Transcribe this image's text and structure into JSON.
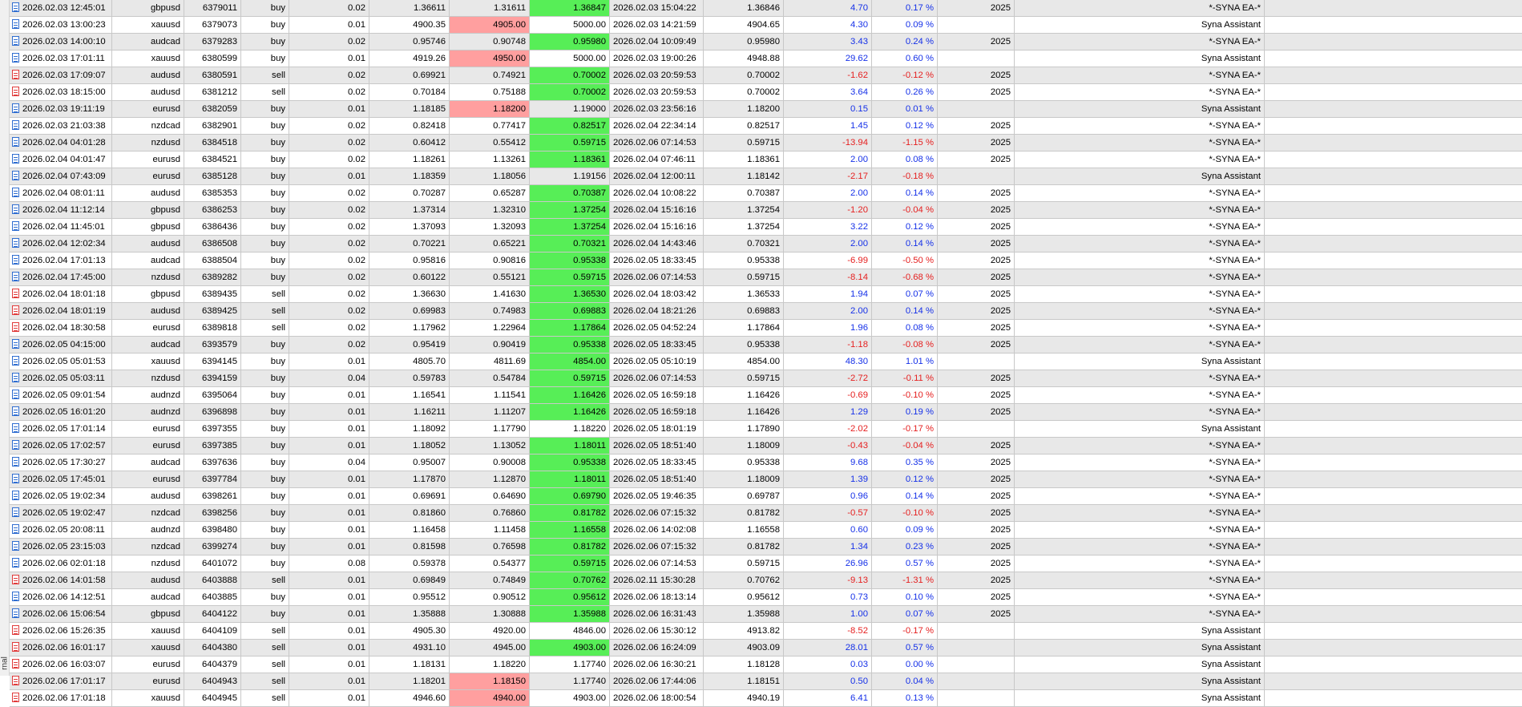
{
  "side_label": "rnal",
  "theme": {
    "profit_color": "#1530e8",
    "loss_color": "#e52020",
    "tp_highlight": "#57ee57",
    "sl_highlight": "#ff9f9f"
  },
  "rows": [
    {
      "time": "2026.02.03 12:45:01",
      "symbol": "gbpusd",
      "ticket": "6379011",
      "type": "buy",
      "volume": "0.02",
      "price": "1.36611",
      "sl": "1.31611",
      "tp": "1.36847",
      "close_time": "2026.02.03 15:04:22",
      "close_price": "1.36846",
      "profit": "4.70",
      "pct": "0.17 %",
      "magic": "2025",
      "comment": "*-SYNA EA-*",
      "hl": "tp"
    },
    {
      "time": "2026.02.03 13:00:23",
      "symbol": "xauusd",
      "ticket": "6379073",
      "type": "buy",
      "volume": "0.01",
      "price": "4900.35",
      "sl": "4905.00",
      "tp": "5000.00",
      "close_time": "2026.02.03 14:21:59",
      "close_price": "4904.65",
      "profit": "4.30",
      "pct": "0.09 %",
      "magic": "",
      "comment": "Syna Assistant",
      "hl": "sl"
    },
    {
      "time": "2026.02.03 14:00:10",
      "symbol": "audcad",
      "ticket": "6379283",
      "type": "buy",
      "volume": "0.02",
      "price": "0.95746",
      "sl": "0.90748",
      "tp": "0.95980",
      "close_time": "2026.02.04 10:09:49",
      "close_price": "0.95980",
      "profit": "3.43",
      "pct": "0.24 %",
      "magic": "2025",
      "comment": "*-SYNA EA-*",
      "hl": "tp"
    },
    {
      "time": "2026.02.03 17:01:11",
      "symbol": "xauusd",
      "ticket": "6380599",
      "type": "buy",
      "volume": "0.01",
      "price": "4919.26",
      "sl": "4950.00",
      "tp": "5000.00",
      "close_time": "2026.02.03 19:00:26",
      "close_price": "4948.88",
      "profit": "29.62",
      "pct": "0.60 %",
      "magic": "",
      "comment": "Syna Assistant",
      "hl": "sl"
    },
    {
      "time": "2026.02.03 17:09:07",
      "symbol": "audusd",
      "ticket": "6380591",
      "type": "sell",
      "volume": "0.02",
      "price": "0.69921",
      "sl": "0.74921",
      "tp": "0.70002",
      "close_time": "2026.02.03 20:59:53",
      "close_price": "0.70002",
      "profit": "-1.62",
      "pct": "-0.12 %",
      "magic": "2025",
      "comment": "*-SYNA EA-*",
      "hl": "tp"
    },
    {
      "time": "2026.02.03 18:15:00",
      "symbol": "audusd",
      "ticket": "6381212",
      "type": "sell",
      "volume": "0.02",
      "price": "0.70184",
      "sl": "0.75188",
      "tp": "0.70002",
      "close_time": "2026.02.03 20:59:53",
      "close_price": "0.70002",
      "profit": "3.64",
      "pct": "0.26 %",
      "magic": "2025",
      "comment": "*-SYNA EA-*",
      "hl": "tp"
    },
    {
      "time": "2026.02.03 19:11:19",
      "symbol": "eurusd",
      "ticket": "6382059",
      "type": "buy",
      "volume": "0.01",
      "price": "1.18185",
      "sl": "1.18200",
      "tp": "1.19000",
      "close_time": "2026.02.03 23:56:16",
      "close_price": "1.18200",
      "profit": "0.15",
      "pct": "0.01 %",
      "magic": "",
      "comment": "Syna Assistant",
      "hl": "sl"
    },
    {
      "time": "2026.02.03 21:03:38",
      "symbol": "nzdcad",
      "ticket": "6382901",
      "type": "buy",
      "volume": "0.02",
      "price": "0.82418",
      "sl": "0.77417",
      "tp": "0.82517",
      "close_time": "2026.02.04 22:34:14",
      "close_price": "0.82517",
      "profit": "1.45",
      "pct": "0.12 %",
      "magic": "2025",
      "comment": "*-SYNA EA-*",
      "hl": "tp"
    },
    {
      "time": "2026.02.04 04:01:28",
      "symbol": "nzdusd",
      "ticket": "6384518",
      "type": "buy",
      "volume": "0.02",
      "price": "0.60412",
      "sl": "0.55412",
      "tp": "0.59715",
      "close_time": "2026.02.06 07:14:53",
      "close_price": "0.59715",
      "profit": "-13.94",
      "pct": "-1.15 %",
      "magic": "2025",
      "comment": "*-SYNA EA-*",
      "hl": "tp"
    },
    {
      "time": "2026.02.04 04:01:47",
      "symbol": "eurusd",
      "ticket": "6384521",
      "type": "buy",
      "volume": "0.02",
      "price": "1.18261",
      "sl": "1.13261",
      "tp": "1.18361",
      "close_time": "2026.02.04 07:46:11",
      "close_price": "1.18361",
      "profit": "2.00",
      "pct": "0.08 %",
      "magic": "2025",
      "comment": "*-SYNA EA-*",
      "hl": "tp"
    },
    {
      "time": "2026.02.04 07:43:09",
      "symbol": "eurusd",
      "ticket": "6385128",
      "type": "buy",
      "volume": "0.01",
      "price": "1.18359",
      "sl": "1.18056",
      "tp": "1.19156",
      "close_time": "2026.02.04 12:00:11",
      "close_price": "1.18142",
      "profit": "-2.17",
      "pct": "-0.18 %",
      "magic": "",
      "comment": "Syna Assistant",
      "hl": ""
    },
    {
      "time": "2026.02.04 08:01:11",
      "symbol": "audusd",
      "ticket": "6385353",
      "type": "buy",
      "volume": "0.02",
      "price": "0.70287",
      "sl": "0.65287",
      "tp": "0.70387",
      "close_time": "2026.02.04 10:08:22",
      "close_price": "0.70387",
      "profit": "2.00",
      "pct": "0.14 %",
      "magic": "2025",
      "comment": "*-SYNA EA-*",
      "hl": "tp"
    },
    {
      "time": "2026.02.04 11:12:14",
      "symbol": "gbpusd",
      "ticket": "6386253",
      "type": "buy",
      "volume": "0.02",
      "price": "1.37314",
      "sl": "1.32310",
      "tp": "1.37254",
      "close_time": "2026.02.04 15:16:16",
      "close_price": "1.37254",
      "profit": "-1.20",
      "pct": "-0.04 %",
      "magic": "2025",
      "comment": "*-SYNA EA-*",
      "hl": "tp"
    },
    {
      "time": "2026.02.04 11:45:01",
      "symbol": "gbpusd",
      "ticket": "6386436",
      "type": "buy",
      "volume": "0.02",
      "price": "1.37093",
      "sl": "1.32093",
      "tp": "1.37254",
      "close_time": "2026.02.04 15:16:16",
      "close_price": "1.37254",
      "profit": "3.22",
      "pct": "0.12 %",
      "magic": "2025",
      "comment": "*-SYNA EA-*",
      "hl": "tp"
    },
    {
      "time": "2026.02.04 12:02:34",
      "symbol": "audusd",
      "ticket": "6386508",
      "type": "buy",
      "volume": "0.02",
      "price": "0.70221",
      "sl": "0.65221",
      "tp": "0.70321",
      "close_time": "2026.02.04 14:43:46",
      "close_price": "0.70321",
      "profit": "2.00",
      "pct": "0.14 %",
      "magic": "2025",
      "comment": "*-SYNA EA-*",
      "hl": "tp"
    },
    {
      "time": "2026.02.04 17:01:13",
      "symbol": "audcad",
      "ticket": "6388504",
      "type": "buy",
      "volume": "0.02",
      "price": "0.95816",
      "sl": "0.90816",
      "tp": "0.95338",
      "close_time": "2026.02.05 18:33:45",
      "close_price": "0.95338",
      "profit": "-6.99",
      "pct": "-0.50 %",
      "magic": "2025",
      "comment": "*-SYNA EA-*",
      "hl": "tp"
    },
    {
      "time": "2026.02.04 17:45:00",
      "symbol": "nzdusd",
      "ticket": "6389282",
      "type": "buy",
      "volume": "0.02",
      "price": "0.60122",
      "sl": "0.55121",
      "tp": "0.59715",
      "close_time": "2026.02.06 07:14:53",
      "close_price": "0.59715",
      "profit": "-8.14",
      "pct": "-0.68 %",
      "magic": "2025",
      "comment": "*-SYNA EA-*",
      "hl": "tp"
    },
    {
      "time": "2026.02.04 18:01:18",
      "symbol": "gbpusd",
      "ticket": "6389435",
      "type": "sell",
      "volume": "0.02",
      "price": "1.36630",
      "sl": "1.41630",
      "tp": "1.36530",
      "close_time": "2026.02.04 18:03:42",
      "close_price": "1.36533",
      "profit": "1.94",
      "pct": "0.07 %",
      "magic": "2025",
      "comment": "*-SYNA EA-*",
      "hl": "tp"
    },
    {
      "time": "2026.02.04 18:01:19",
      "symbol": "audusd",
      "ticket": "6389425",
      "type": "sell",
      "volume": "0.02",
      "price": "0.69983",
      "sl": "0.74983",
      "tp": "0.69883",
      "close_time": "2026.02.04 18:21:26",
      "close_price": "0.69883",
      "profit": "2.00",
      "pct": "0.14 %",
      "magic": "2025",
      "comment": "*-SYNA EA-*",
      "hl": "tp"
    },
    {
      "time": "2026.02.04 18:30:58",
      "symbol": "eurusd",
      "ticket": "6389818",
      "type": "sell",
      "volume": "0.02",
      "price": "1.17962",
      "sl": "1.22964",
      "tp": "1.17864",
      "close_time": "2026.02.05 04:52:24",
      "close_price": "1.17864",
      "profit": "1.96",
      "pct": "0.08 %",
      "magic": "2025",
      "comment": "*-SYNA EA-*",
      "hl": "tp"
    },
    {
      "time": "2026.02.05 04:15:00",
      "symbol": "audcad",
      "ticket": "6393579",
      "type": "buy",
      "volume": "0.02",
      "price": "0.95419",
      "sl": "0.90419",
      "tp": "0.95338",
      "close_time": "2026.02.05 18:33:45",
      "close_price": "0.95338",
      "profit": "-1.18",
      "pct": "-0.08 %",
      "magic": "2025",
      "comment": "*-SYNA EA-*",
      "hl": "tp"
    },
    {
      "time": "2026.02.05 05:01:53",
      "symbol": "xauusd",
      "ticket": "6394145",
      "type": "buy",
      "volume": "0.01",
      "price": "4805.70",
      "sl": "4811.69",
      "tp": "4854.00",
      "close_time": "2026.02.05 05:10:19",
      "close_price": "4854.00",
      "profit": "48.30",
      "pct": "1.01 %",
      "magic": "",
      "comment": "Syna Assistant",
      "hl": "tp"
    },
    {
      "time": "2026.02.05 05:03:11",
      "symbol": "nzdusd",
      "ticket": "6394159",
      "type": "buy",
      "volume": "0.04",
      "price": "0.59783",
      "sl": "0.54784",
      "tp": "0.59715",
      "close_time": "2026.02.06 07:14:53",
      "close_price": "0.59715",
      "profit": "-2.72",
      "pct": "-0.11 %",
      "magic": "2025",
      "comment": "*-SYNA EA-*",
      "hl": "tp"
    },
    {
      "time": "2026.02.05 09:01:54",
      "symbol": "audnzd",
      "ticket": "6395064",
      "type": "buy",
      "volume": "0.01",
      "price": "1.16541",
      "sl": "1.11541",
      "tp": "1.16426",
      "close_time": "2026.02.05 16:59:18",
      "close_price": "1.16426",
      "profit": "-0.69",
      "pct": "-0.10 %",
      "magic": "2025",
      "comment": "*-SYNA EA-*",
      "hl": "tp"
    },
    {
      "time": "2026.02.05 16:01:20",
      "symbol": "audnzd",
      "ticket": "6396898",
      "type": "buy",
      "volume": "0.01",
      "price": "1.16211",
      "sl": "1.11207",
      "tp": "1.16426",
      "close_time": "2026.02.05 16:59:18",
      "close_price": "1.16426",
      "profit": "1.29",
      "pct": "0.19 %",
      "magic": "2025",
      "comment": "*-SYNA EA-*",
      "hl": "tp"
    },
    {
      "time": "2026.02.05 17:01:14",
      "symbol": "eurusd",
      "ticket": "6397355",
      "type": "buy",
      "volume": "0.01",
      "price": "1.18092",
      "sl": "1.17790",
      "tp": "1.18220",
      "close_time": "2026.02.05 18:01:19",
      "close_price": "1.17890",
      "profit": "-2.02",
      "pct": "-0.17 %",
      "magic": "",
      "comment": "Syna Assistant",
      "hl": ""
    },
    {
      "time": "2026.02.05 17:02:57",
      "symbol": "eurusd",
      "ticket": "6397385",
      "type": "buy",
      "volume": "0.01",
      "price": "1.18052",
      "sl": "1.13052",
      "tp": "1.18011",
      "close_time": "2026.02.05 18:51:40",
      "close_price": "1.18009",
      "profit": "-0.43",
      "pct": "-0.04 %",
      "magic": "2025",
      "comment": "*-SYNA EA-*",
      "hl": "tp"
    },
    {
      "time": "2026.02.05 17:30:27",
      "symbol": "audcad",
      "ticket": "6397636",
      "type": "buy",
      "volume": "0.04",
      "price": "0.95007",
      "sl": "0.90008",
      "tp": "0.95338",
      "close_time": "2026.02.05 18:33:45",
      "close_price": "0.95338",
      "profit": "9.68",
      "pct": "0.35 %",
      "magic": "2025",
      "comment": "*-SYNA EA-*",
      "hl": "tp"
    },
    {
      "time": "2026.02.05 17:45:01",
      "symbol": "eurusd",
      "ticket": "6397784",
      "type": "buy",
      "volume": "0.01",
      "price": "1.17870",
      "sl": "1.12870",
      "tp": "1.18011",
      "close_time": "2026.02.05 18:51:40",
      "close_price": "1.18009",
      "profit": "1.39",
      "pct": "0.12 %",
      "magic": "2025",
      "comment": "*-SYNA EA-*",
      "hl": "tp"
    },
    {
      "time": "2026.02.05 19:02:34",
      "symbol": "audusd",
      "ticket": "6398261",
      "type": "buy",
      "volume": "0.01",
      "price": "0.69691",
      "sl": "0.64690",
      "tp": "0.69790",
      "close_time": "2026.02.05 19:46:35",
      "close_price": "0.69787",
      "profit": "0.96",
      "pct": "0.14 %",
      "magic": "2025",
      "comment": "*-SYNA EA-*",
      "hl": "tp"
    },
    {
      "time": "2026.02.05 19:02:47",
      "symbol": "nzdcad",
      "ticket": "6398256",
      "type": "buy",
      "volume": "0.01",
      "price": "0.81860",
      "sl": "0.76860",
      "tp": "0.81782",
      "close_time": "2026.02.06 07:15:32",
      "close_price": "0.81782",
      "profit": "-0.57",
      "pct": "-0.10 %",
      "magic": "2025",
      "comment": "*-SYNA EA-*",
      "hl": "tp"
    },
    {
      "time": "2026.02.05 20:08:11",
      "symbol": "audnzd",
      "ticket": "6398480",
      "type": "buy",
      "volume": "0.01",
      "price": "1.16458",
      "sl": "1.11458",
      "tp": "1.16558",
      "close_time": "2026.02.06 14:02:08",
      "close_price": "1.16558",
      "profit": "0.60",
      "pct": "0.09 %",
      "magic": "2025",
      "comment": "*-SYNA EA-*",
      "hl": "tp"
    },
    {
      "time": "2026.02.05 23:15:03",
      "symbol": "nzdcad",
      "ticket": "6399274",
      "type": "buy",
      "volume": "0.01",
      "price": "0.81598",
      "sl": "0.76598",
      "tp": "0.81782",
      "close_time": "2026.02.06 07:15:32",
      "close_price": "0.81782",
      "profit": "1.34",
      "pct": "0.23 %",
      "magic": "2025",
      "comment": "*-SYNA EA-*",
      "hl": "tp"
    },
    {
      "time": "2026.02.06 02:01:18",
      "symbol": "nzdusd",
      "ticket": "6401072",
      "type": "buy",
      "volume": "0.08",
      "price": "0.59378",
      "sl": "0.54377",
      "tp": "0.59715",
      "close_time": "2026.02.06 07:14:53",
      "close_price": "0.59715",
      "profit": "26.96",
      "pct": "0.57 %",
      "magic": "2025",
      "comment": "*-SYNA EA-*",
      "hl": "tp"
    },
    {
      "time": "2026.02.06 14:01:58",
      "symbol": "audusd",
      "ticket": "6403888",
      "type": "sell",
      "volume": "0.01",
      "price": "0.69849",
      "sl": "0.74849",
      "tp": "0.70762",
      "close_time": "2026.02.11 15:30:28",
      "close_price": "0.70762",
      "profit": "-9.13",
      "pct": "-1.31 %",
      "magic": "2025",
      "comment": "*-SYNA EA-*",
      "hl": "tp"
    },
    {
      "time": "2026.02.06 14:12:51",
      "symbol": "audcad",
      "ticket": "6403885",
      "type": "buy",
      "volume": "0.01",
      "price": "0.95512",
      "sl": "0.90512",
      "tp": "0.95612",
      "close_time": "2026.02.06 18:13:14",
      "close_price": "0.95612",
      "profit": "0.73",
      "pct": "0.10 %",
      "magic": "2025",
      "comment": "*-SYNA EA-*",
      "hl": "tp"
    },
    {
      "time": "2026.02.06 15:06:54",
      "symbol": "gbpusd",
      "ticket": "6404122",
      "type": "buy",
      "volume": "0.01",
      "price": "1.35888",
      "sl": "1.30888",
      "tp": "1.35988",
      "close_time": "2026.02.06 16:31:43",
      "close_price": "1.35988",
      "profit": "1.00",
      "pct": "0.07 %",
      "magic": "2025",
      "comment": "*-SYNA EA-*",
      "hl": "tp"
    },
    {
      "time": "2026.02.06 15:26:35",
      "symbol": "xauusd",
      "ticket": "6404109",
      "type": "sell",
      "volume": "0.01",
      "price": "4905.30",
      "sl": "4920.00",
      "tp": "4846.00",
      "close_time": "2026.02.06 15:30:12",
      "close_price": "4913.82",
      "profit": "-8.52",
      "pct": "-0.17 %",
      "magic": "",
      "comment": "Syna Assistant",
      "hl": ""
    },
    {
      "time": "2026.02.06 16:01:17",
      "symbol": "xauusd",
      "ticket": "6404380",
      "type": "sell",
      "volume": "0.01",
      "price": "4931.10",
      "sl": "4945.00",
      "tp": "4903.00",
      "close_time": "2026.02.06 16:24:09",
      "close_price": "4903.09",
      "profit": "28.01",
      "pct": "0.57 %",
      "magic": "",
      "comment": "Syna Assistant",
      "hl": "tp"
    },
    {
      "time": "2026.02.06 16:03:07",
      "symbol": "eurusd",
      "ticket": "6404379",
      "type": "sell",
      "volume": "0.01",
      "price": "1.18131",
      "sl": "1.18220",
      "tp": "1.17740",
      "close_time": "2026.02.06 16:30:21",
      "close_price": "1.18128",
      "profit": "0.03",
      "pct": "0.00 %",
      "magic": "",
      "comment": "Syna Assistant",
      "hl": ""
    },
    {
      "time": "2026.02.06 17:01:17",
      "symbol": "eurusd",
      "ticket": "6404943",
      "type": "sell",
      "volume": "0.01",
      "price": "1.18201",
      "sl": "1.18150",
      "tp": "1.17740",
      "close_time": "2026.02.06 17:44:06",
      "close_price": "1.18151",
      "profit": "0.50",
      "pct": "0.04 %",
      "magic": "",
      "comment": "Syna Assistant",
      "hl": "sl"
    },
    {
      "time": "2026.02.06 17:01:18",
      "symbol": "xauusd",
      "ticket": "6404945",
      "type": "sell",
      "volume": "0.01",
      "price": "4946.60",
      "sl": "4940.00",
      "tp": "4903.00",
      "close_time": "2026.02.06 18:00:54",
      "close_price": "4940.19",
      "profit": "6.41",
      "pct": "0.13 %",
      "magic": "",
      "comment": "Syna Assistant",
      "hl": "sl"
    }
  ]
}
